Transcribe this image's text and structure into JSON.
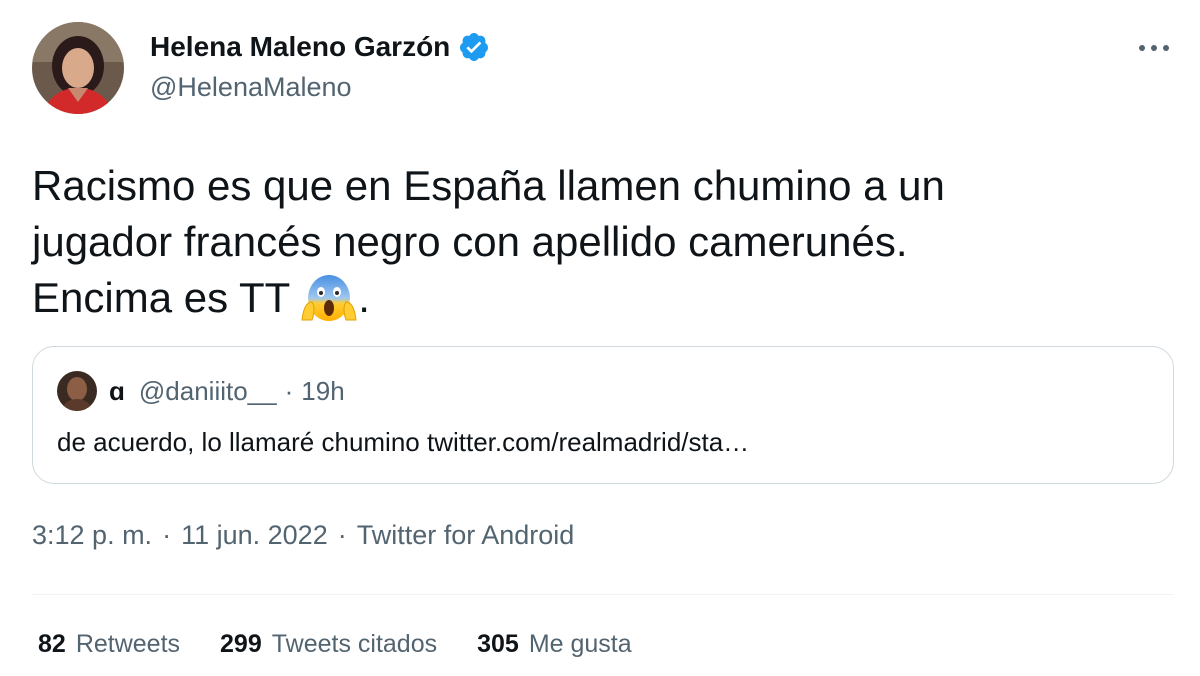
{
  "author": {
    "name": "Helena Maleno Garzón",
    "handle": "@HelenaMaleno",
    "verified": true
  },
  "more_icon": "more-dots-icon",
  "tweet": {
    "lines": [
      "Racismo es que en España llamen chumino a un",
      "jugador francés negro con apellido camerunés.",
      "Encima es TT"
    ],
    "emoji": "face-screaming-in-fear",
    "trailing": "."
  },
  "quoted": {
    "name": "ɑ",
    "handle": "@daniiito__",
    "separator": "·",
    "time": "19h",
    "text": "de acuerdo, lo llamaré chumino twitter.com/realmadrid/sta…"
  },
  "meta": {
    "time": "3:12 p. m.",
    "date": "11 jun. 2022",
    "source": "Twitter for Android",
    "separator": "·"
  },
  "stats": {
    "retweets": {
      "count": "82",
      "label": "Retweets"
    },
    "quotes": {
      "count": "299",
      "label": "Tweets citados"
    },
    "likes": {
      "count": "305",
      "label": "Me gusta"
    }
  },
  "colors": {
    "text": "#0f1419",
    "secondary": "#536471",
    "verified": "#1d9bf0",
    "border": "#cfd9de"
  }
}
